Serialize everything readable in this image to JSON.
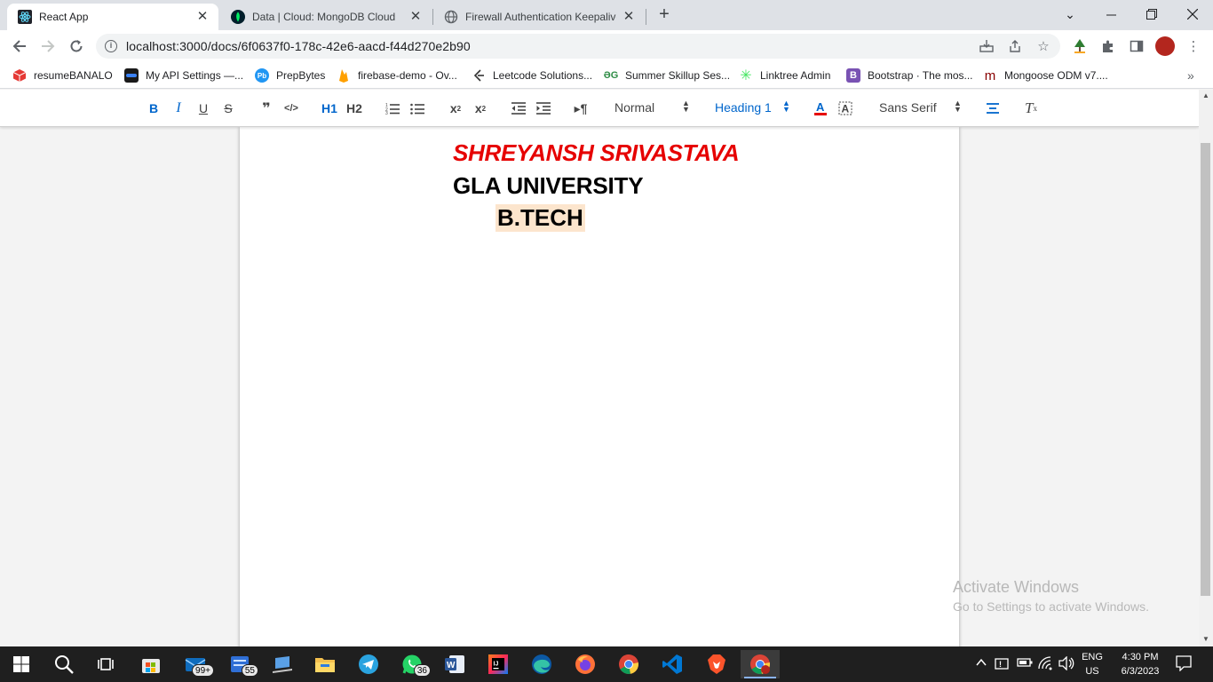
{
  "browser": {
    "tabs": [
      {
        "title": "React App",
        "active": true,
        "icon": "react-icon"
      },
      {
        "title": "Data | Cloud: MongoDB Cloud",
        "active": false,
        "icon": "mongodb-leaf-icon"
      },
      {
        "title": "Firewall Authentication Keepalive",
        "active": false,
        "icon": "globe-icon"
      }
    ],
    "new_tab_label": "+",
    "url": "localhost:3000/docs/6f0637f0-178c-42e6-aacd-f44d270e2b90",
    "bookmarks": [
      {
        "label": "resumeBANALO",
        "icon": "cube-icon",
        "color": "#e53935"
      },
      {
        "label": "My API Settings —...",
        "icon": "api-icon",
        "color": "#1a1a1a"
      },
      {
        "label": "PrepBytes",
        "icon": "pb-icon",
        "color": "#2196f3"
      },
      {
        "label": "firebase-demo - Ov...",
        "icon": "firebase-icon",
        "color": "#ffa000"
      },
      {
        "label": "Leetcode Solutions...",
        "icon": "leetcode-icon",
        "color": "#333333"
      },
      {
        "label": "Summer Skillup Ses...",
        "icon": "gfg-icon",
        "color": "#2f8d46"
      },
      {
        "label": "Linktree Admin",
        "icon": "linktree-icon",
        "color": "#43e660"
      },
      {
        "label": "Bootstrap · The mos...",
        "icon": "bootstrap-icon",
        "color": "#7952b3"
      },
      {
        "label": "Mongoose ODM v7....",
        "icon": "mongoose-icon",
        "color": "#880000"
      }
    ]
  },
  "editor": {
    "toolbar": {
      "bold": "B",
      "italic": "I",
      "underline": "U",
      "strike": "S",
      "blockquote": "❞",
      "code": "</>",
      "h1": "H1",
      "h2": "H2",
      "header_picker": "Normal",
      "size_picker": "Heading 1",
      "font_picker": "Sans Serif"
    },
    "lines": [
      {
        "text": "SHREYANSH SRIVASTAVA",
        "color": "#e60000",
        "italic": true,
        "bold": true
      },
      {
        "text": "GLA UNIVERSITY",
        "color": "#000000",
        "bold": true
      },
      {
        "text": "B.TECH",
        "color": "#000000",
        "bold": true,
        "background": "#fce5cd"
      }
    ]
  },
  "watermark": {
    "title": "Activate Windows",
    "subtitle": "Go to Settings to activate Windows."
  },
  "taskbar": {
    "apps": [
      {
        "name": "mail",
        "badge": "99+"
      },
      {
        "name": "tasks",
        "badge": "55"
      },
      {
        "name": "whatsapp",
        "badge": "36"
      }
    ],
    "language": "ENG",
    "region": "US",
    "time": "4:30 PM",
    "date": "6/3/2023"
  }
}
